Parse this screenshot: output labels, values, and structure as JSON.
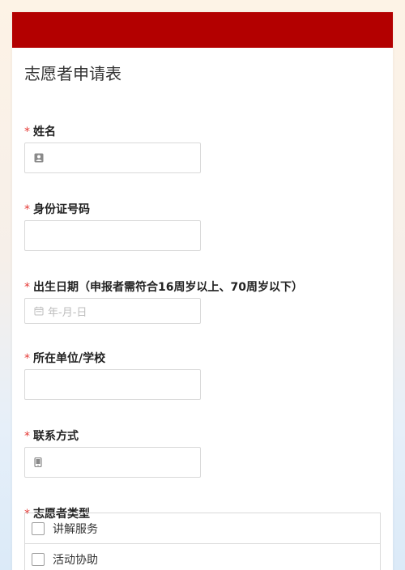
{
  "form": {
    "title": "志愿者申请表",
    "banner_color": "#b30000",
    "required_marker": "*"
  },
  "fields": [
    {
      "label": "姓名",
      "icon": "person-icon"
    },
    {
      "label": "身份证号码"
    },
    {
      "label": "出生日期（申报者需符合16周岁以上、70周岁以下）",
      "icon": "calendar-icon",
      "placeholder": "年-月-日"
    },
    {
      "label": "所在单位/学校"
    },
    {
      "label": "联系方式",
      "icon": "phone-icon"
    },
    {
      "label": "志愿者类型"
    }
  ],
  "volunteer_types": {
    "options": [
      "讲解服务",
      "活动协助"
    ]
  }
}
